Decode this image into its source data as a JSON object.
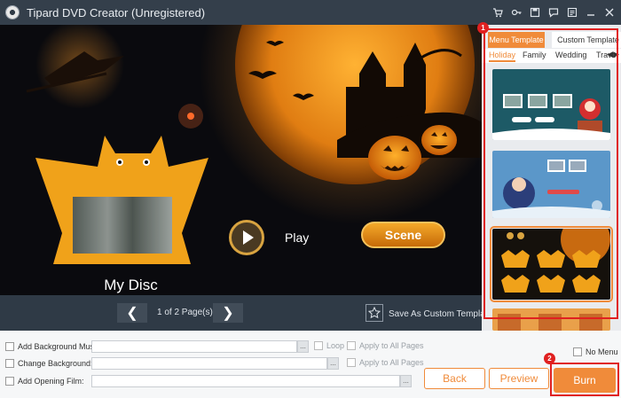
{
  "window": {
    "title": "Tipard DVD Creator (Unregistered)"
  },
  "titlebar_icons": [
    "cart-icon",
    "key-icon",
    "save-icon",
    "feedback-icon",
    "menu-icon",
    "minimize-icon",
    "close-icon"
  ],
  "preview": {
    "disc_title": "My Disc",
    "play_label": "Play",
    "scene_label": "Scene"
  },
  "pager": {
    "page_text": "1 of 2 Page(s)",
    "save_template": "Save As Custom Template"
  },
  "template_panel": {
    "tabs": [
      "Menu Template",
      "Custom Template"
    ],
    "categories": [
      "Holiday",
      "Family",
      "Wedding",
      "Trave"
    ],
    "active_category": "Holiday",
    "selected_index": 2
  },
  "options": {
    "bg_music": "Add Background Music:",
    "loop": "Loop",
    "apply_all_1": "Apply to All Pages",
    "change_bg": "Change Background:",
    "apply_all_2": "Apply to All Pages",
    "opening_film": "Add Opening Film:",
    "no_menu": "No Menu",
    "browse": "..."
  },
  "buttons": {
    "back": "Back",
    "preview": "Preview",
    "burn": "Burn"
  },
  "callouts": {
    "one": "1",
    "two": "2"
  },
  "colors": {
    "accent": "#f08b3a",
    "highlight_red": "#e02020"
  }
}
